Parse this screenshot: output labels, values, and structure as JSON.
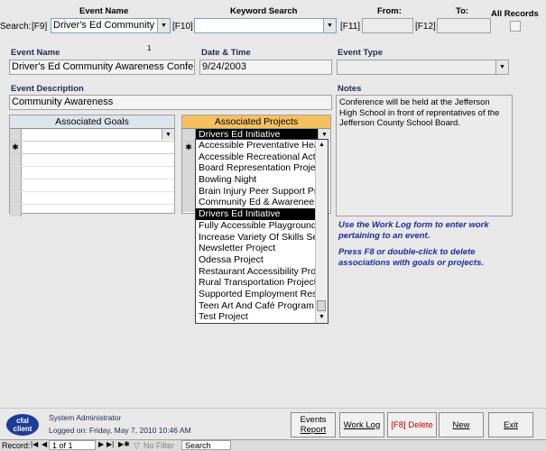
{
  "search_bar": {
    "event_name_label": "Event Name",
    "keyword_label": "Keyword Search",
    "from_label": "From:",
    "to_label": "To:",
    "all_records_label": "All Records",
    "search_label": "Search:",
    "f9": "[F9]",
    "f10": "[F10]",
    "f11": "[F11]",
    "f12": "[F12]",
    "event_name_value": "Driver's Ed Community Awa",
    "keyword_value": "",
    "from_value": "",
    "to_value": ""
  },
  "record_count": "1",
  "event": {
    "name_label": "Event Name",
    "name_value": "Driver's Ed Community Awareness Conference",
    "datetime_label": "Date & Time",
    "datetime_value": "9/24/2003",
    "type_label": "Event Type",
    "type_value": "",
    "desc_label": "Event Description",
    "desc_value": "Community Awareness",
    "notes_label": "Notes",
    "notes_value": "Conference will be held at the Jefferson High School in front of reprentatives of the Jefferson County School Board."
  },
  "goals": {
    "header": "Associated Goals",
    "new_row_marker": "✱"
  },
  "projects": {
    "header": "Associated Projects",
    "selected_value": "Drivers Ed Initiative",
    "new_row_marker": "✱",
    "items": [
      "Accessible Preventative Health",
      "Accessible Recreational Activities",
      "Board Representation Project",
      "Bowling Night",
      "Brain Injury Peer Support Program",
      "Community Ed & Awarenee",
      "Drivers Ed Initiative",
      "Fully Accessible Playground",
      "Increase Variety Of Skills Services",
      "Newsletter Project",
      "Odessa Project",
      "Restaurant Accessibility Project",
      "Rural Transportation Project",
      "Supported Employment Resources",
      "Teen Art And Café Program",
      "Test Project"
    ],
    "highlighted_index": 6
  },
  "hints": {
    "hint1": "Use the Work Log form to enter work pertaining to an event.",
    "hint2": "Press F8 or double-click to delete associations with goals or projects."
  },
  "footer": {
    "logo_text_1": "cfal",
    "logo_text_2": "client",
    "user": "System Administrator",
    "logged_on": "Logged on: Friday, May 7, 2010 10:46 AM",
    "btn_events_report_1": "Events",
    "btn_events_report_2": "Report",
    "btn_work_log": "Work Log",
    "btn_delete": "[F8] Delete",
    "btn_new": "New",
    "btn_exit": "Exit"
  },
  "statusbar": {
    "record_label": "Record:",
    "position": "1 of 1",
    "no_filter": "No Filter",
    "search": "Search"
  },
  "colors": {
    "projects_header": "#f5c060",
    "hint_text": "#1a2ea0",
    "delete_text": "#c00000"
  }
}
